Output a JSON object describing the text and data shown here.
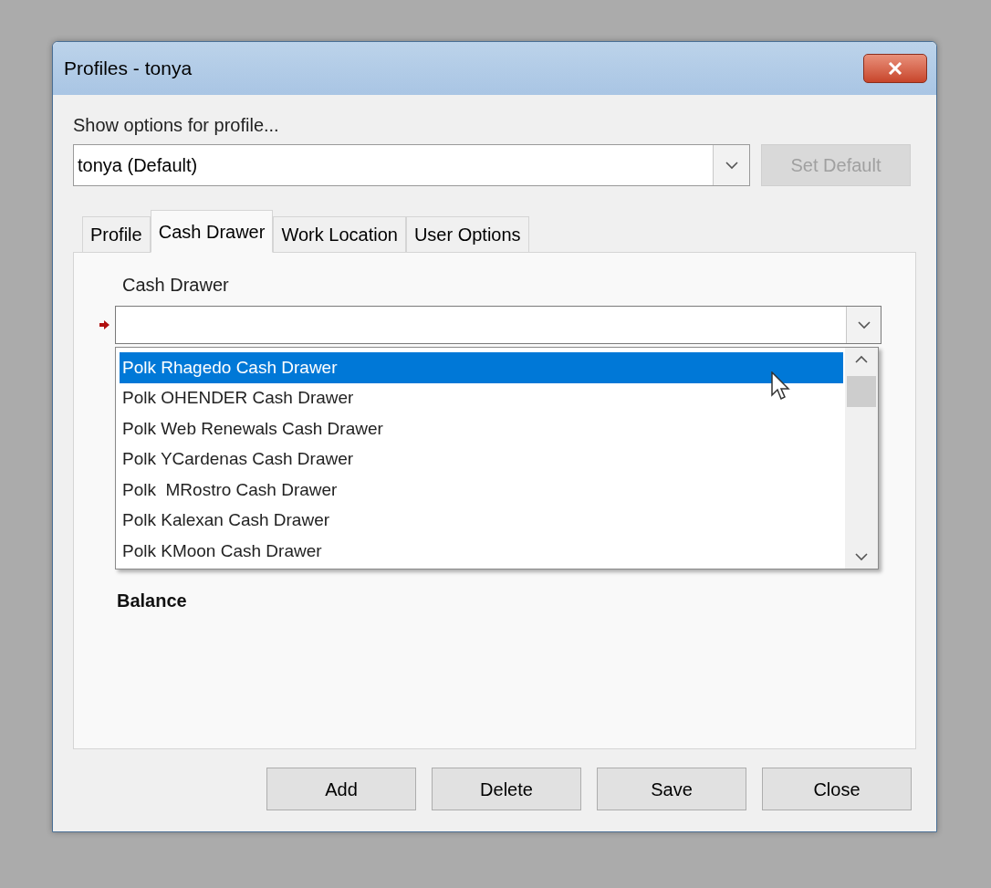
{
  "window": {
    "title": "Profiles - tonya"
  },
  "profile_picker": {
    "label": "Show options for profile...",
    "value": "tonya (Default)"
  },
  "set_default_button": {
    "label": "Set Default",
    "disabled": true
  },
  "tabs": [
    {
      "label": "Profile",
      "selected": false
    },
    {
      "label": "Cash Drawer",
      "selected": true
    },
    {
      "label": "Work Location",
      "selected": false
    },
    {
      "label": "User Options",
      "selected": false
    }
  ],
  "cash_drawer": {
    "label": "Cash Drawer",
    "required": true,
    "expanded": true,
    "options": [
      {
        "label": "Polk Rhagedo Cash Drawer",
        "selected": true
      },
      {
        "label": "Polk OHENDER Cash Drawer",
        "selected": false
      },
      {
        "label": "Polk Web Renewals Cash Drawer",
        "selected": false
      },
      {
        "label": "Polk YCardenas Cash Drawer",
        "selected": false
      },
      {
        "label": "Polk  MRostro Cash Drawer",
        "selected": false
      },
      {
        "label": "Polk Kalexan Cash Drawer",
        "selected": false
      },
      {
        "label": "Polk KMoon Cash Drawer",
        "selected": false
      }
    ]
  },
  "balance_label": "Balance",
  "buttons": [
    {
      "label": "Add"
    },
    {
      "label": "Delete"
    },
    {
      "label": "Save"
    },
    {
      "label": "Close"
    }
  ]
}
